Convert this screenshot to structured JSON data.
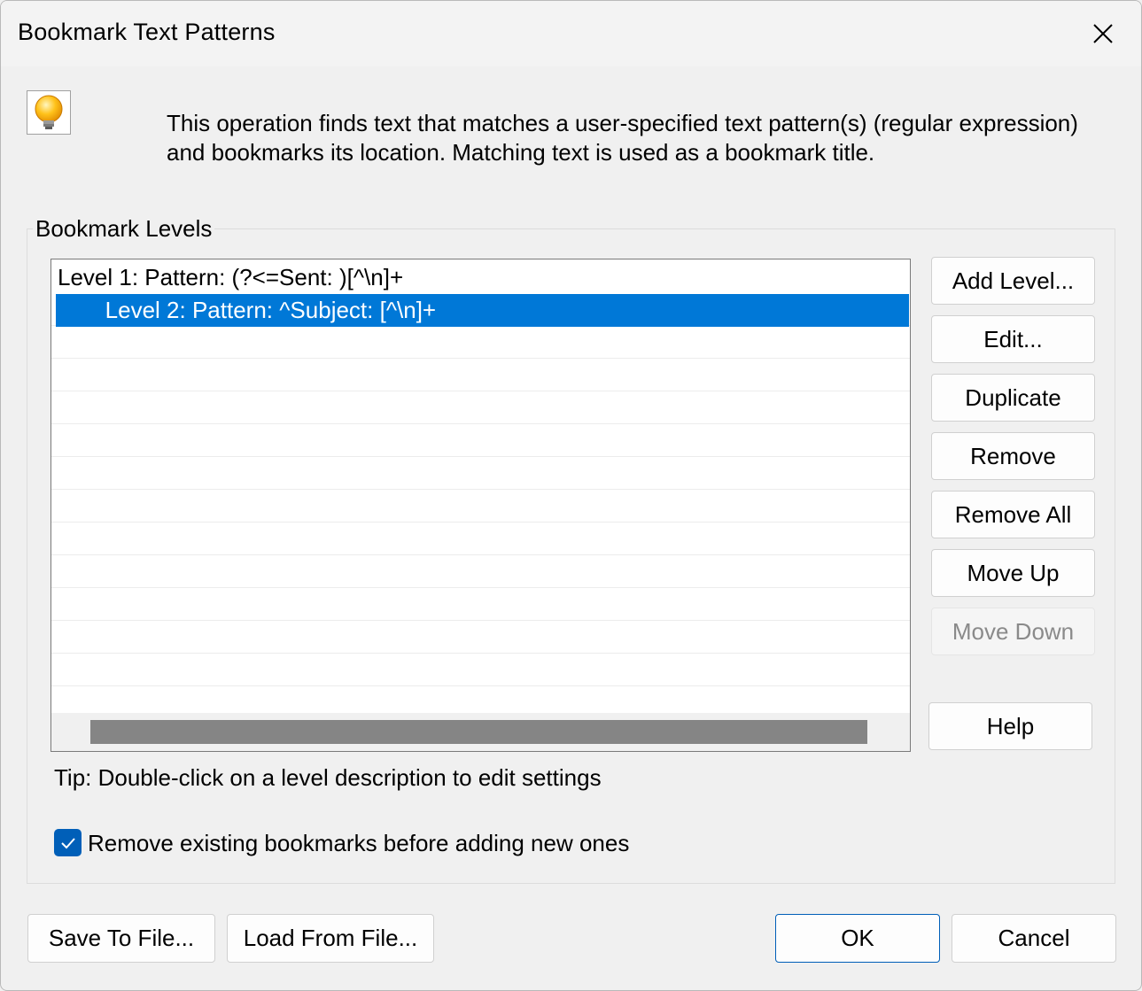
{
  "dialog": {
    "title": "Bookmark Text Patterns",
    "description": "This operation finds text that matches a user-specified text pattern(s) (regular expression) and bookmarks its location. Matching text is used as a bookmark title."
  },
  "levels_group": {
    "label": "Bookmark Levels",
    "items": [
      {
        "label": "Level 1: Pattern: (?<=Sent: )[^\\n]+",
        "selected": false
      },
      {
        "label": "   Level 2: Pattern: ^Subject: [^\\n]+",
        "selected": true
      }
    ]
  },
  "side_buttons": {
    "add_level": "Add Level...",
    "edit": "Edit...",
    "duplicate": "Duplicate",
    "remove": "Remove",
    "remove_all": "Remove All",
    "move_up": "Move Up",
    "move_down": "Move Down",
    "help": "Help"
  },
  "tip": "Tip: Double-click on a level description to edit settings",
  "remove_existing": {
    "label": "Remove existing bookmarks before adding new ones",
    "checked": true
  },
  "footer": {
    "save_to_file": "Save To File...",
    "load_from_file": "Load From File...",
    "ok": "OK",
    "cancel": "Cancel"
  },
  "colors": {
    "selection": "#0078d7",
    "accent": "#005fb8"
  },
  "icons": [
    "close-icon",
    "lightbulb-icon",
    "checkmark-icon"
  ]
}
